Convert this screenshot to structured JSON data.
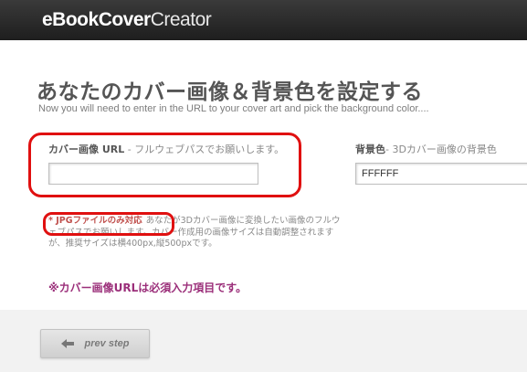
{
  "header": {
    "logo_part1": "eBook",
    "logo_part2": "Cover",
    "logo_part3": "Creator"
  },
  "page": {
    "title": "あなたのカバー画像＆背景色を設定する",
    "subtitle": "Now you will need to enter in the URL to your cover art and pick the background color...."
  },
  "cover_url": {
    "label": "カバー画像 URL",
    "hint": " - フルウェブパスでお願いします。",
    "value": "",
    "note_jpg": "* JPGファイルのみ対応",
    "note_text": "あなたが3Dカバー画像に変換したい画像のフルウェブパスでお願いします。カバー作成用の画像サイズは自動調整されますが、推奨サイズは横400px,縦500pxです。",
    "required_text": "※カバー画像URLは必須入力項目です。"
  },
  "background": {
    "label": "背景色",
    "hint": "- 3Dカバー画像の背景色",
    "value": "FFFFFF"
  },
  "nav": {
    "prev_label": "prev step",
    "prev_icon": "arrow-left-icon"
  },
  "colors": {
    "header_bg": "#262626",
    "highlight": "#e01010",
    "required_text": "#9b2f7a"
  }
}
